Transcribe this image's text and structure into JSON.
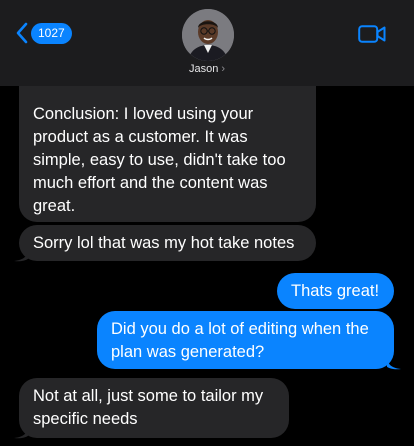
{
  "header": {
    "back_count": "1027",
    "contact_name": "Jason",
    "contact_chevron": "›",
    "back_icon": "chevron-left-icon",
    "video_icon": "video-camera-icon",
    "accent_color": "#0a84ff"
  },
  "messages": [
    {
      "direction": "incoming",
      "text": "Conclusion: I loved using your product as a customer. It was simple, easy to use, didn't take too much effort and the content was great."
    },
    {
      "direction": "incoming",
      "text": "Sorry lol that was my hot take notes"
    },
    {
      "direction": "outgoing",
      "text": "Thats great!"
    },
    {
      "direction": "outgoing",
      "text": "Did you do a lot of editing when the plan was generated?"
    },
    {
      "direction": "incoming",
      "text": "Not at all, just some to tailor my specific needs"
    }
  ],
  "colors": {
    "incoming_bubble": "#262628",
    "outgoing_bubble": "#0a84ff",
    "background": "#000000"
  }
}
